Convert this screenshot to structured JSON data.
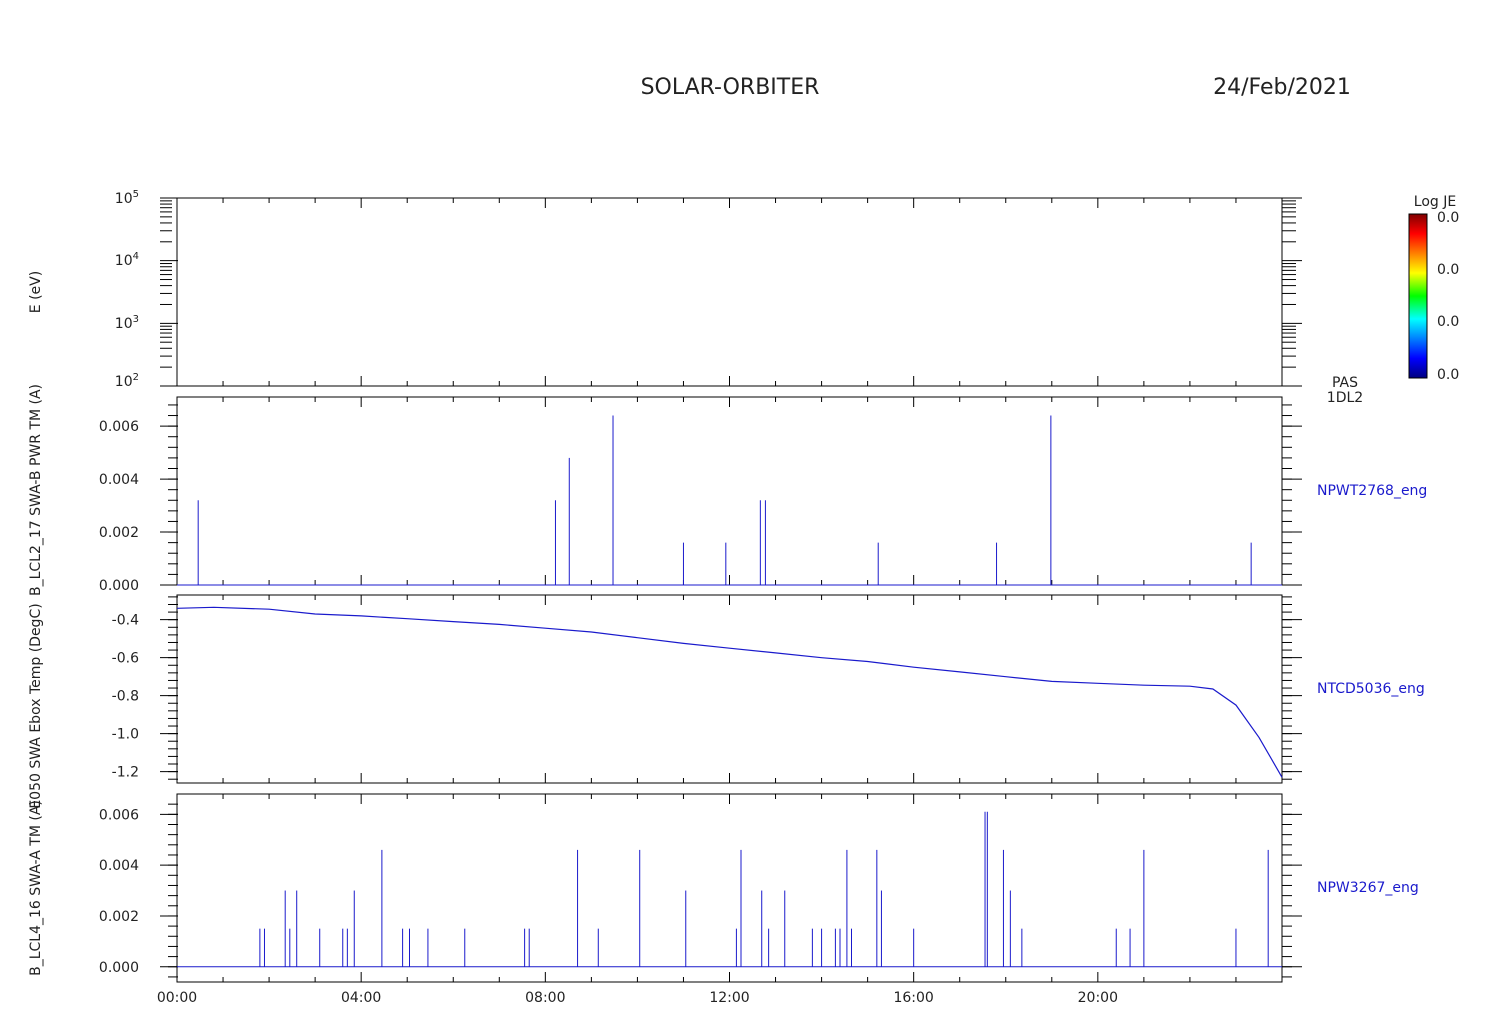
{
  "header": {
    "mission": "SOLAR-ORBITER",
    "date": "24/Feb/2021"
  },
  "colorbar": {
    "title": "Log JE",
    "tick_labels": [
      "0.0",
      "0.0",
      "0.0",
      "0.0"
    ]
  },
  "colors": {
    "trace": "#1a1acc",
    "axes": "#000000"
  },
  "chart_data": [
    {
      "type": "heatmap",
      "ylabel": "E (eV)",
      "yscale": "log",
      "ylim": [
        100,
        100000
      ],
      "ytick_labels": [
        "10^2",
        "10^3",
        "10^4",
        "10^5"
      ],
      "side_label": [
        "PAS",
        "1DL2"
      ],
      "xlim": [
        0,
        24
      ],
      "data": []
    },
    {
      "type": "line",
      "ylabel": "B_LCL2_17 SWA-B PWR TM (A)",
      "side_label": "NPWT2768_eng",
      "xlim": [
        0,
        24
      ],
      "ylim": [
        0,
        0.0071
      ],
      "ytick_labels": [
        "0.000",
        "0.002",
        "0.004",
        "0.006"
      ],
      "ytick_values": [
        0,
        0.002,
        0.004,
        0.006
      ],
      "spikes": [
        {
          "x": 0.46,
          "y": 0.0032
        },
        {
          "x": 8.22,
          "y": 0.0032
        },
        {
          "x": 8.52,
          "y": 0.0048
        },
        {
          "x": 9.47,
          "y": 0.0064
        },
        {
          "x": 11.0,
          "y": 0.0016
        },
        {
          "x": 11.92,
          "y": 0.0016
        },
        {
          "x": 12.67,
          "y": 0.0032
        },
        {
          "x": 12.78,
          "y": 0.0032
        },
        {
          "x": 15.23,
          "y": 0.0016
        },
        {
          "x": 17.8,
          "y": 0.0016
        },
        {
          "x": 18.98,
          "y": 0.0064
        },
        {
          "x": 23.33,
          "y": 0.0016
        }
      ]
    },
    {
      "type": "line",
      "ylabel": "E050 SWA Ebox Temp (DegC)",
      "side_label": "NTCD5036_eng",
      "xlim": [
        0,
        24
      ],
      "ylim": [
        -1.26,
        -0.27
      ],
      "ytick_labels": [
        "-0.4",
        "-0.6",
        "-0.8",
        "-1.0",
        "-1.2"
      ],
      "ytick_values": [
        -0.4,
        -0.6,
        -0.8,
        -1.0,
        -1.2
      ],
      "x": [
        0,
        0.8,
        2,
        3,
        4,
        5,
        6,
        7,
        8,
        9,
        10,
        11,
        12,
        13,
        14,
        15,
        16,
        17,
        18,
        19,
        20,
        21,
        22,
        22.5,
        23,
        23.5,
        24
      ],
      "y": [
        -0.34,
        -0.335,
        -0.345,
        -0.37,
        -0.38,
        -0.395,
        -0.41,
        -0.425,
        -0.445,
        -0.465,
        -0.495,
        -0.525,
        -0.55,
        -0.575,
        -0.6,
        -0.62,
        -0.65,
        -0.675,
        -0.7,
        -0.725,
        -0.735,
        -0.745,
        -0.75,
        -0.765,
        -0.85,
        -1.02,
        -1.23
      ]
    },
    {
      "type": "line",
      "ylabel": "B_LCL4_16 SWA-A TM (A)",
      "side_label": "NPW3267_eng",
      "xlim": [
        0,
        24
      ],
      "ylim": [
        -0.0006,
        0.0068
      ],
      "ytick_labels": [
        "0.000",
        "0.002",
        "0.004",
        "0.006"
      ],
      "ytick_values": [
        0,
        0.002,
        0.004,
        0.006
      ],
      "xtick_labels": [
        "00:00",
        "04:00",
        "08:00",
        "12:00",
        "16:00",
        "20:00"
      ],
      "xtick_values": [
        0,
        4,
        8,
        12,
        16,
        20
      ],
      "spikes": [
        {
          "x": 1.8,
          "y": 0.0015
        },
        {
          "x": 1.9,
          "y": 0.0015
        },
        {
          "x": 2.35,
          "y": 0.003
        },
        {
          "x": 2.45,
          "y": 0.0015
        },
        {
          "x": 2.6,
          "y": 0.003
        },
        {
          "x": 3.1,
          "y": 0.0015
        },
        {
          "x": 3.6,
          "y": 0.0015
        },
        {
          "x": 3.7,
          "y": 0.0015
        },
        {
          "x": 3.85,
          "y": 0.003
        },
        {
          "x": 4.45,
          "y": 0.0046
        },
        {
          "x": 4.9,
          "y": 0.0015
        },
        {
          "x": 5.05,
          "y": 0.0015
        },
        {
          "x": 5.45,
          "y": 0.0015
        },
        {
          "x": 6.25,
          "y": 0.0015
        },
        {
          "x": 7.55,
          "y": 0.0015
        },
        {
          "x": 7.65,
          "y": 0.0015
        },
        {
          "x": 8.7,
          "y": 0.0046
        },
        {
          "x": 9.15,
          "y": 0.0015
        },
        {
          "x": 10.05,
          "y": 0.0046
        },
        {
          "x": 11.05,
          "y": 0.003
        },
        {
          "x": 12.15,
          "y": 0.0015
        },
        {
          "x": 12.25,
          "y": 0.0046
        },
        {
          "x": 12.7,
          "y": 0.003
        },
        {
          "x": 12.85,
          "y": 0.0015
        },
        {
          "x": 13.2,
          "y": 0.003
        },
        {
          "x": 13.8,
          "y": 0.0015
        },
        {
          "x": 14.0,
          "y": 0.0015
        },
        {
          "x": 14.3,
          "y": 0.0015
        },
        {
          "x": 14.4,
          "y": 0.0015
        },
        {
          "x": 14.55,
          "y": 0.0046
        },
        {
          "x": 14.65,
          "y": 0.0015
        },
        {
          "x": 15.2,
          "y": 0.0046
        },
        {
          "x": 15.3,
          "y": 0.003
        },
        {
          "x": 16.0,
          "y": 0.0015
        },
        {
          "x": 17.55,
          "y": 0.0061
        },
        {
          "x": 17.6,
          "y": 0.0061
        },
        {
          "x": 17.95,
          "y": 0.0046
        },
        {
          "x": 18.1,
          "y": 0.003
        },
        {
          "x": 18.35,
          "y": 0.0015
        },
        {
          "x": 20.4,
          "y": 0.0015
        },
        {
          "x": 20.7,
          "y": 0.0015
        },
        {
          "x": 21.0,
          "y": 0.0046
        },
        {
          "x": 23.0,
          "y": 0.0015
        },
        {
          "x": 23.7,
          "y": 0.0046
        }
      ]
    }
  ]
}
